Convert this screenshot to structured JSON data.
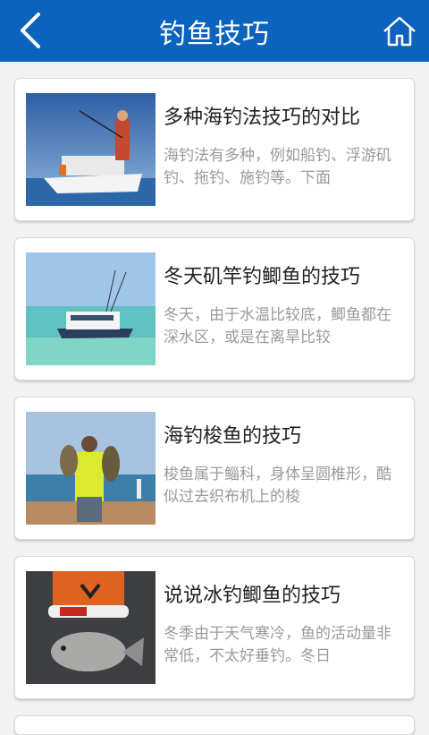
{
  "header": {
    "title": "钓鱼技巧",
    "back_icon": "back-arrow-icon",
    "home_icon": "home-icon"
  },
  "articles": [
    {
      "title": "多种海钓法技巧的对比",
      "summary": "海钓法有多种，例如船钓、浮游矶钓、拖钓、施钓等。下面"
    },
    {
      "title": "冬天矶竿钓鲫鱼的技巧",
      "summary": "冬天，由于水温比较底，鲫鱼都在深水区，或是在离旱比较"
    },
    {
      "title": "海钓梭鱼的技巧",
      "summary": "梭鱼属于鲻科，身体呈圆椎形，酷似过去织布机上的梭"
    },
    {
      "title": "说说冰钓鲫鱼的技巧",
      "summary": "冬季由于天气寒冷，鱼的活动量非常低，不太好垂钓。冬日"
    }
  ],
  "colors": {
    "header": "#0b63bd",
    "background": "#f2f2f2",
    "title_text": "#222222",
    "summary_text": "#9a9a9a"
  }
}
